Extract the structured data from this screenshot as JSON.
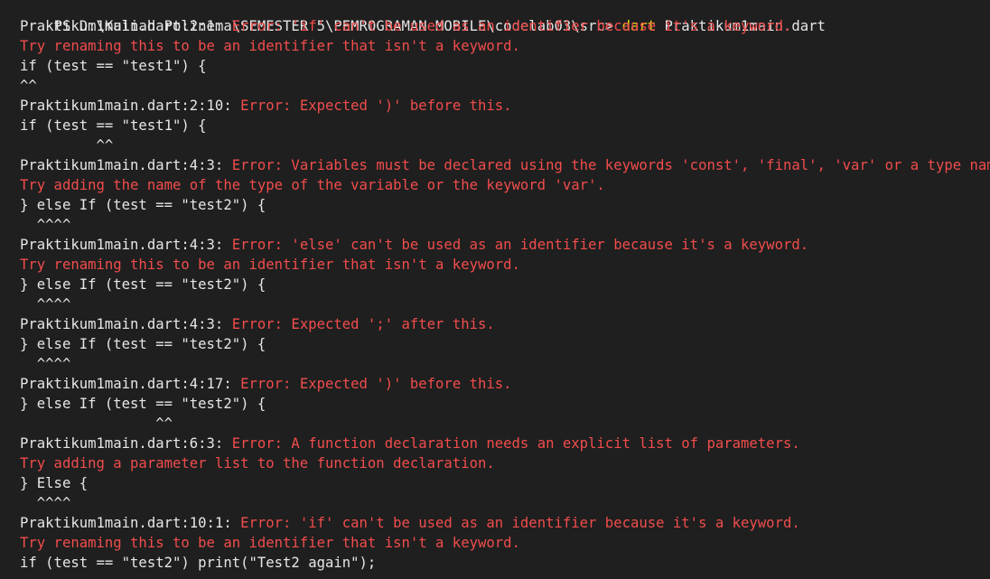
{
  "prompt": {
    "path": "PS D:\\Kuliah Polinema\\SEMESTER 5\\PEMROGRAMAN MOBILE\\codelab03\\src> ",
    "command": "dart",
    "argument": " Praktikum1main.dart"
  },
  "errors": [
    {
      "location": "Praktikum1main.dart:2:1: ",
      "message": "Error: 'if' can't be used as an identifier because it's a keyword.",
      "hint": "Try renaming this to be an identifier that isn't a keyword.",
      "code": "if (test == \"test1\") {",
      "caret": "^^"
    },
    {
      "location": "Praktikum1main.dart:2:10: ",
      "message": "Error: Expected ')' before this.",
      "hint": null,
      "code": "if (test == \"test1\") {",
      "caret": "         ^^"
    },
    {
      "location": "Praktikum1main.dart:4:3: ",
      "message": "Error: Variables must be declared using the keywords 'const', 'final', 'var' or a type name.",
      "hint": "Try adding the name of the type of the variable or the keyword 'var'.",
      "code": "} else If (test == \"test2\") {",
      "caret": "  ^^^^"
    },
    {
      "location": "Praktikum1main.dart:4:3: ",
      "message": "Error: 'else' can't be used as an identifier because it's a keyword.",
      "hint": "Try renaming this to be an identifier that isn't a keyword.",
      "code": "} else If (test == \"test2\") {",
      "caret": "  ^^^^"
    },
    {
      "location": "Praktikum1main.dart:4:3: ",
      "message": "Error: Expected ';' after this.",
      "hint": null,
      "code": "} else If (test == \"test2\") {",
      "caret": "  ^^^^"
    },
    {
      "location": "Praktikum1main.dart:4:17: ",
      "message": "Error: Expected ')' before this.",
      "hint": null,
      "code": "} else If (test == \"test2\") {",
      "caret": "                ^^"
    },
    {
      "location": "Praktikum1main.dart:6:3: ",
      "message": "Error: A function declaration needs an explicit list of parameters.",
      "hint": "Try adding a parameter list to the function declaration.",
      "code": "} Else {",
      "caret": "  ^^^^"
    },
    {
      "location": "Praktikum1main.dart:10:1: ",
      "message": "Error: 'if' can't be used as an identifier because it's a keyword.",
      "hint": "Try renaming this to be an identifier that isn't a keyword.",
      "code": "if (test == \"test2\") print(\"Test2 again\");",
      "caret": null
    }
  ],
  "colors": {
    "background": "#1f1f1f",
    "text": "#e6e6e6",
    "error": "#f14c4c",
    "command": "#e5e510"
  }
}
